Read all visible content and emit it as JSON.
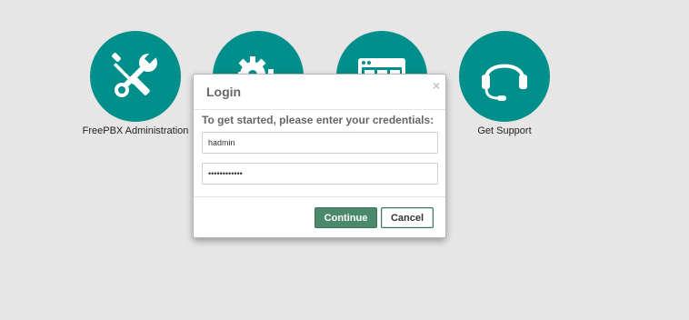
{
  "tiles": [
    {
      "label": "FreePBX Administration",
      "icon": "tools-icon"
    },
    {
      "label": "",
      "icon": "gears-icon"
    },
    {
      "label": "",
      "icon": "dashboard-window-icon"
    },
    {
      "label": "Get Support",
      "icon": "headset-icon"
    }
  ],
  "login_dialog": {
    "title": "Login",
    "close_symbol": "×",
    "prompt": "To get started, please enter your credentials:",
    "username_value": "hadmin",
    "password_value": "hadminhadmin",
    "continue_label": "Continue",
    "cancel_label": "Cancel"
  },
  "colors": {
    "background": "#e6e6e6",
    "tile_accent": "#008f8a",
    "primary_button": "#4a8a6b"
  }
}
